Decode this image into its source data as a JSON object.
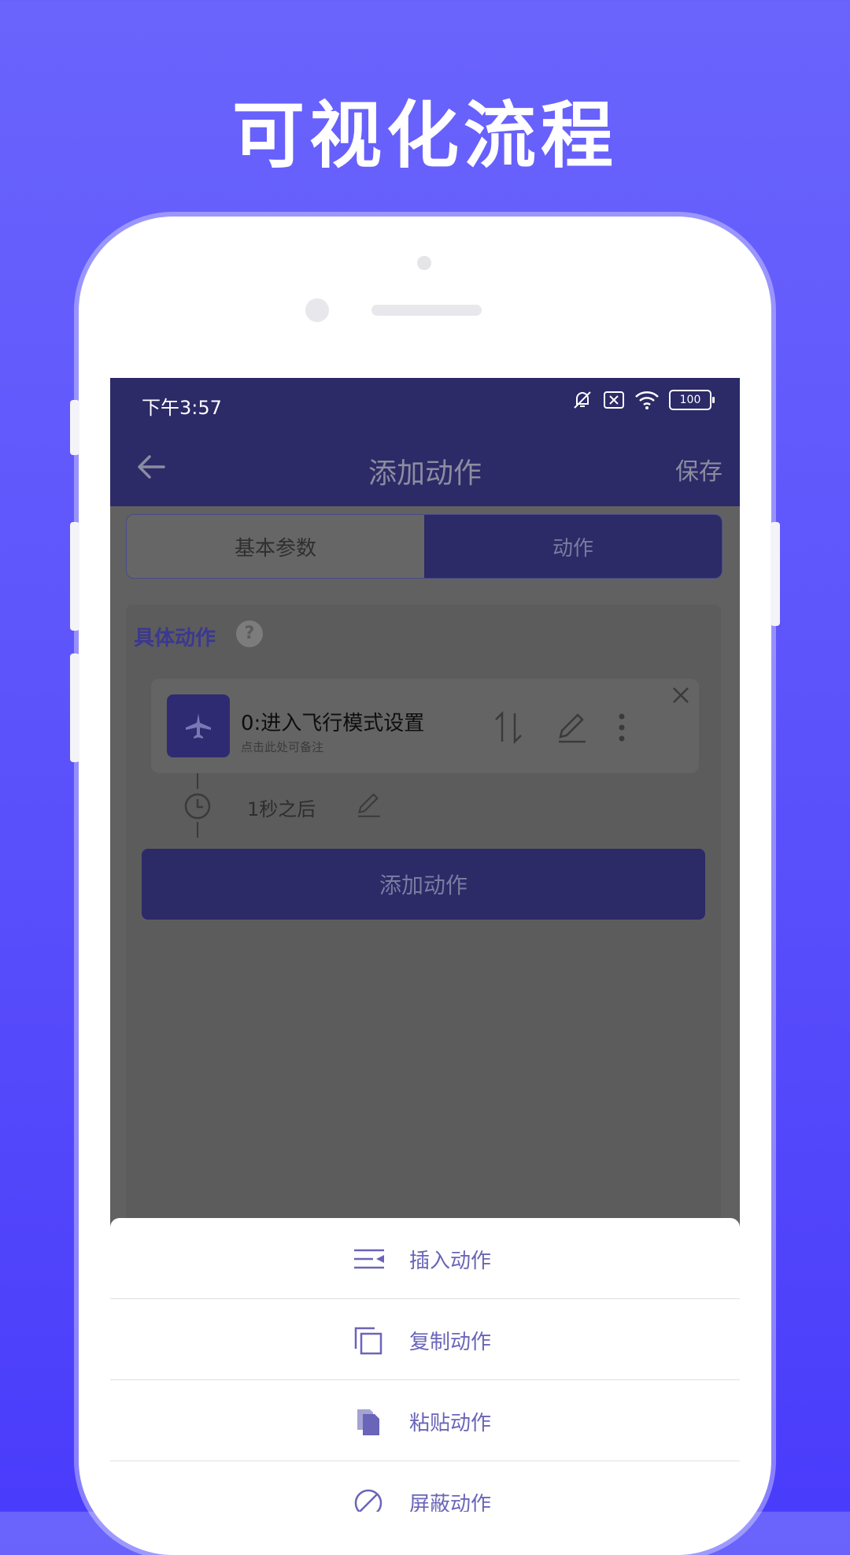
{
  "promo": {
    "headline": "可视化流程"
  },
  "status_bar": {
    "time": "下午3:57",
    "battery": "100"
  },
  "app_bar": {
    "title": "添加动作",
    "save_label": "保存"
  },
  "tabs": [
    {
      "label": "基本参数"
    },
    {
      "label": "动作"
    }
  ],
  "panel": {
    "title": "具体动作",
    "help": "?",
    "action": {
      "name": "0:进入飞行模式设置",
      "note": "点击此处可备注"
    },
    "delay": "1秒之后",
    "add_button": "添加动作"
  },
  "sheet": {
    "items": [
      {
        "label": "插入动作",
        "icon": "insert-icon"
      },
      {
        "label": "复制动作",
        "icon": "copy-icon"
      },
      {
        "label": "粘贴动作",
        "icon": "paste-icon"
      },
      {
        "label": "屏蔽动作",
        "icon": "block-icon"
      }
    ]
  },
  "colors": {
    "primary": "#2c2a67",
    "accent": "#6a65b8",
    "background": "#5a50fb"
  }
}
